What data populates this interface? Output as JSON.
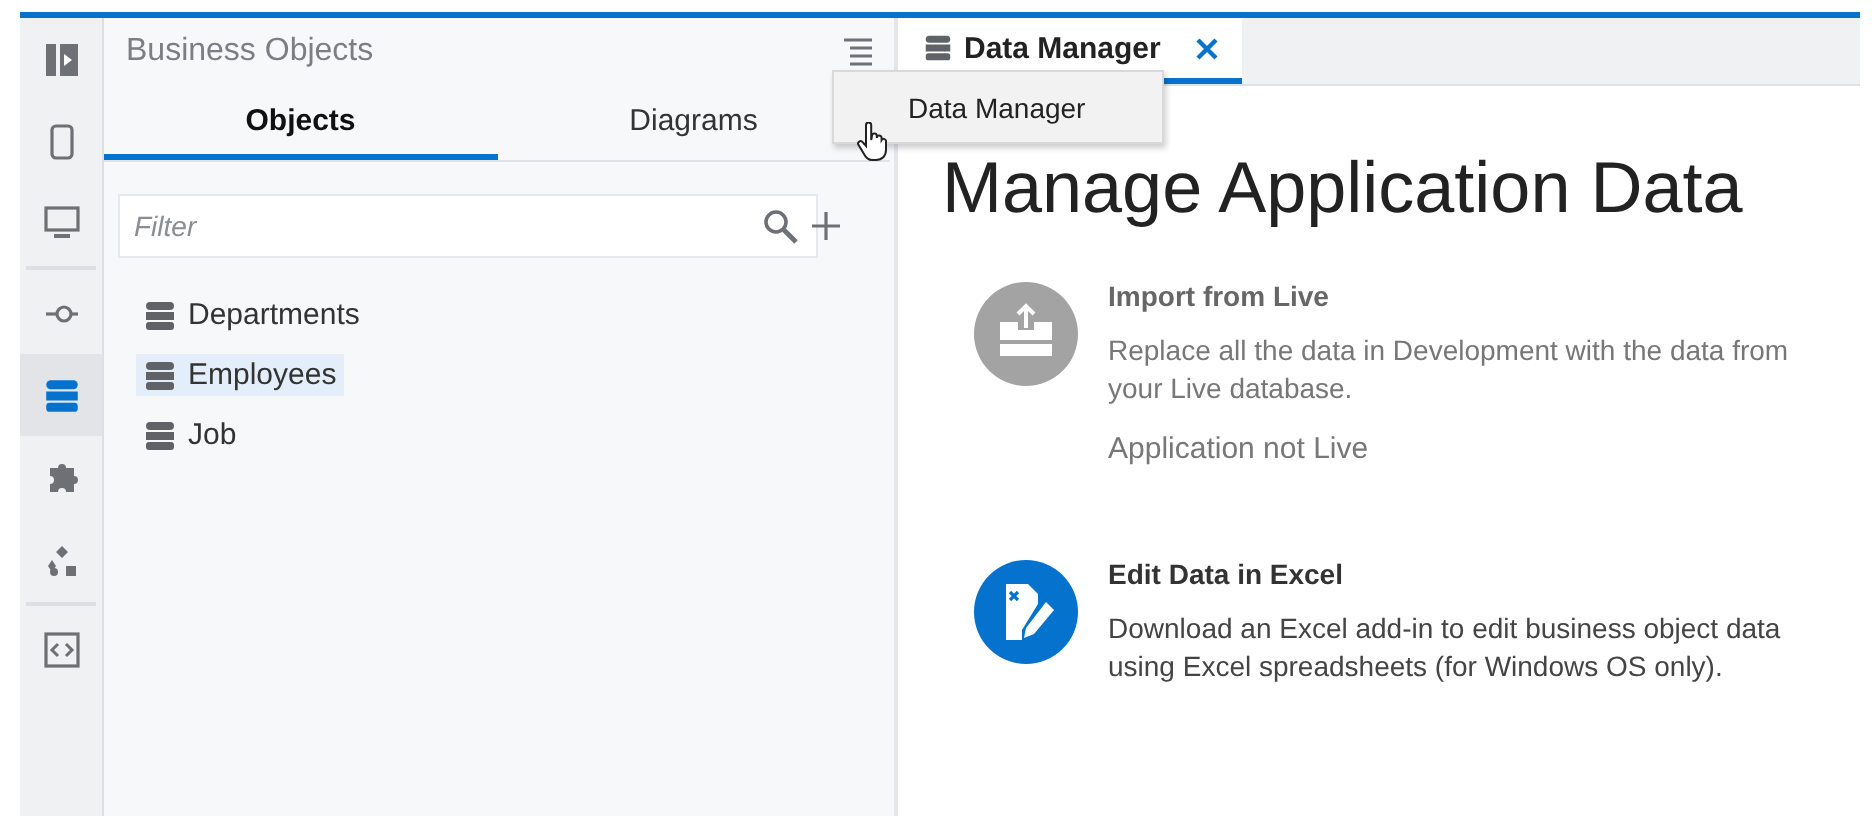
{
  "rail": {
    "groups": [
      [
        {
          "kind": "collapse",
          "selected": false
        },
        {
          "kind": "mobile",
          "selected": false
        },
        {
          "kind": "desktop",
          "selected": false
        }
      ],
      [
        {
          "kind": "process",
          "selected": false
        },
        {
          "kind": "database",
          "selected": true
        },
        {
          "kind": "puzzle",
          "selected": false
        },
        {
          "kind": "diagram",
          "selected": false
        }
      ],
      [
        {
          "kind": "code",
          "selected": false
        }
      ]
    ]
  },
  "panel": {
    "title": "Business Objects",
    "tabs": [
      {
        "label": "Objects",
        "selected": true
      },
      {
        "label": "Diagrams",
        "selected": false
      }
    ],
    "filter": {
      "placeholder": "Filter"
    },
    "items": [
      {
        "label": "Departments",
        "selected": false
      },
      {
        "label": "Employees",
        "selected": true
      },
      {
        "label": "Job",
        "selected": false
      }
    ],
    "menu": {
      "items": [
        "Data Manager"
      ]
    }
  },
  "editor": {
    "tabs": [
      {
        "label": "Data Manager",
        "selected": true
      }
    ],
    "heading": "Manage Application Data",
    "cards": [
      {
        "kind": "import",
        "disabled": true,
        "title": "Import from Live",
        "description": "Replace all the data in Development with the data from your Live database.",
        "status": "Application not Live"
      },
      {
        "kind": "excel",
        "disabled": false,
        "title": "Edit Data in Excel",
        "description": "Download an Excel add-in to edit business object data using Excel spreadsheets (for Windows OS only)."
      }
    ]
  }
}
